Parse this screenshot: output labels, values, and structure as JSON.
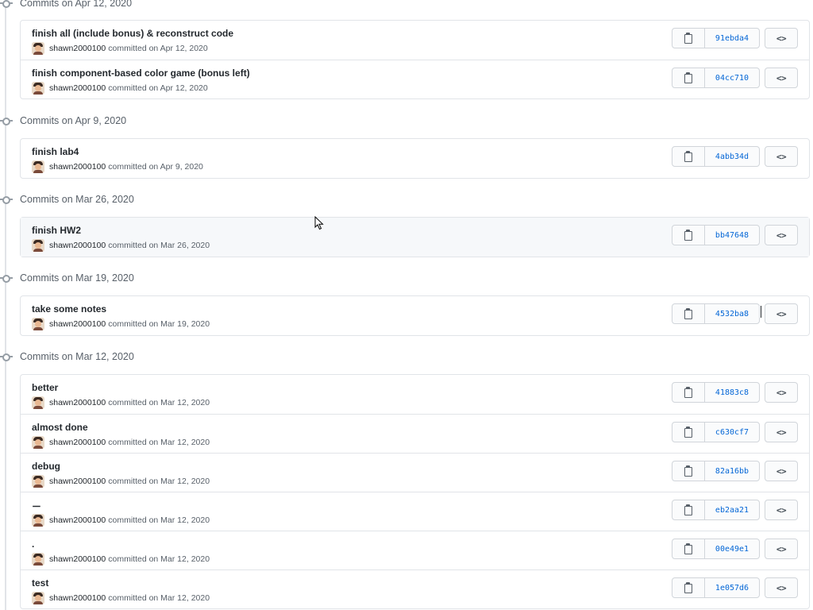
{
  "groups": [
    {
      "heading": "Commits on Apr 12, 2020",
      "commits": [
        {
          "title": "finish all (include bonus) & reconstruct code",
          "author": "shawn2000100",
          "meta": "committed on Apr 12, 2020",
          "sha": "91ebda4"
        },
        {
          "title": "finish component-based color game (bonus left)",
          "author": "shawn2000100",
          "meta": "committed on Apr 12, 2020",
          "sha": "04cc710"
        }
      ]
    },
    {
      "heading": "Commits on Apr 9, 2020",
      "commits": [
        {
          "title": "finish lab4",
          "author": "shawn2000100",
          "meta": "committed on Apr 9, 2020",
          "sha": "4abb34d"
        }
      ]
    },
    {
      "heading": "Commits on Mar 26, 2020",
      "commits": [
        {
          "title": "finish HW2",
          "author": "shawn2000100",
          "meta": "committed on Mar 26, 2020",
          "sha": "bb47648"
        }
      ]
    },
    {
      "heading": "Commits on Mar 19, 2020",
      "commits": [
        {
          "title": "take some notes",
          "author": "shawn2000100",
          "meta": "committed on Mar 19, 2020",
          "sha": "4532ba8"
        }
      ]
    },
    {
      "heading": "Commits on Mar 12, 2020",
      "commits": [
        {
          "title": "better",
          "author": "shawn2000100",
          "meta": "committed on Mar 12, 2020",
          "sha": "41883c8"
        },
        {
          "title": "almost done",
          "author": "shawn2000100",
          "meta": "committed on Mar 12, 2020",
          "sha": "c630cf7"
        },
        {
          "title": "debug",
          "author": "shawn2000100",
          "meta": "committed on Mar 12, 2020",
          "sha": "82a16bb"
        },
        {
          "title": "ㄧ",
          "author": "shawn2000100",
          "meta": "committed on Mar 12, 2020",
          "sha": "eb2aa21"
        },
        {
          "title": ".",
          "author": "shawn2000100",
          "meta": "committed on Mar 12, 2020",
          "sha": "00e49e1"
        },
        {
          "title": "test",
          "author": "shawn2000100",
          "meta": "committed on Mar 12, 2020",
          "sha": "1e057d6"
        }
      ]
    }
  ],
  "icons": {
    "copy": "clipboard-icon",
    "browse": "code-icon",
    "node": "git-commit-icon",
    "avatar": "avatar"
  },
  "browse_glyph": "<>",
  "colors": {
    "sha_link": "#0366d6",
    "border": "#e1e4e8",
    "hover_row": "#f6f8fa"
  }
}
